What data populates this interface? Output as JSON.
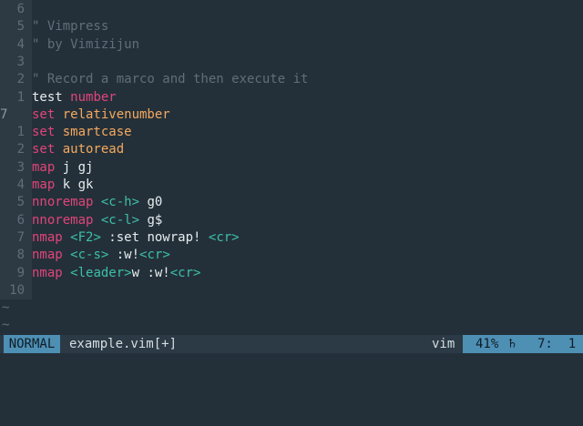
{
  "buffer": {
    "lines": [
      {
        "num": "6",
        "current": false,
        "tokens": []
      },
      {
        "num": "5",
        "current": false,
        "tokens": [
          {
            "t": "\" Vimpress",
            "c": "comment"
          }
        ]
      },
      {
        "num": "4",
        "current": false,
        "tokens": [
          {
            "t": "\" by Vimizijun",
            "c": "comment"
          }
        ]
      },
      {
        "num": "3",
        "current": false,
        "tokens": []
      },
      {
        "num": "2",
        "current": false,
        "tokens": [
          {
            "t": "\" Record a marco and then execute it",
            "c": "comment"
          }
        ]
      },
      {
        "num": "1",
        "current": false,
        "tokens": [
          {
            "t": "test ",
            "c": "plain"
          },
          {
            "t": "number",
            "c": "keyword"
          }
        ]
      },
      {
        "num": "7",
        "current": true,
        "tokens": [
          {
            "t": "set ",
            "c": "keyword"
          },
          {
            "t": "relativenumber",
            "c": "option"
          }
        ]
      },
      {
        "num": "1",
        "current": false,
        "tokens": [
          {
            "t": "set ",
            "c": "keyword"
          },
          {
            "t": "smartcase",
            "c": "option"
          }
        ]
      },
      {
        "num": "2",
        "current": false,
        "tokens": [
          {
            "t": "set ",
            "c": "keyword"
          },
          {
            "t": "autoread",
            "c": "option"
          }
        ]
      },
      {
        "num": "3",
        "current": false,
        "tokens": [
          {
            "t": "map",
            "c": "keyword"
          },
          {
            "t": " j gj",
            "c": "plain"
          }
        ]
      },
      {
        "num": "4",
        "current": false,
        "tokens": [
          {
            "t": "map",
            "c": "keyword"
          },
          {
            "t": " k gk",
            "c": "plain"
          }
        ]
      },
      {
        "num": "5",
        "current": false,
        "tokens": [
          {
            "t": "nnoremap",
            "c": "keyword"
          },
          {
            "t": " ",
            "c": "plain"
          },
          {
            "t": "<c-h>",
            "c": "key"
          },
          {
            "t": " g0",
            "c": "plain"
          }
        ]
      },
      {
        "num": "6",
        "current": false,
        "tokens": [
          {
            "t": "nnoremap",
            "c": "keyword"
          },
          {
            "t": " ",
            "c": "plain"
          },
          {
            "t": "<c-l>",
            "c": "key"
          },
          {
            "t": " g$",
            "c": "plain"
          }
        ]
      },
      {
        "num": "7",
        "current": false,
        "tokens": [
          {
            "t": "nmap",
            "c": "keyword"
          },
          {
            "t": " ",
            "c": "plain"
          },
          {
            "t": "<F2>",
            "c": "key"
          },
          {
            "t": " :set nowrap! ",
            "c": "plain"
          },
          {
            "t": "<cr>",
            "c": "key"
          }
        ]
      },
      {
        "num": "8",
        "current": false,
        "tokens": [
          {
            "t": "nmap",
            "c": "keyword"
          },
          {
            "t": " ",
            "c": "plain"
          },
          {
            "t": "<c-s>",
            "c": "key"
          },
          {
            "t": " :w!",
            "c": "plain"
          },
          {
            "t": "<cr>",
            "c": "key"
          }
        ]
      },
      {
        "num": "9",
        "current": false,
        "tokens": [
          {
            "t": "nmap",
            "c": "keyword"
          },
          {
            "t": " ",
            "c": "plain"
          },
          {
            "t": "<leader>",
            "c": "key"
          },
          {
            "t": "w :w!",
            "c": "plain"
          },
          {
            "t": "<cr>",
            "c": "key"
          }
        ]
      },
      {
        "num": "10",
        "current": false,
        "tokens": []
      }
    ],
    "tildes": [
      "~",
      "~"
    ]
  },
  "statusline": {
    "mode": "NORMAL",
    "filename": "example.vim[+]",
    "filetype": "vim",
    "percent": "41%",
    "scroll_icon": "♄",
    "cursor": "7:  1"
  },
  "colors": {
    "background": "#243039",
    "gutter": "#2d3a43",
    "comment": "#5f6e79",
    "keyword": "#e0457b",
    "option": "#f4a95f",
    "key": "#3cc0a8",
    "statusline_accent": "#4e8fb4"
  }
}
